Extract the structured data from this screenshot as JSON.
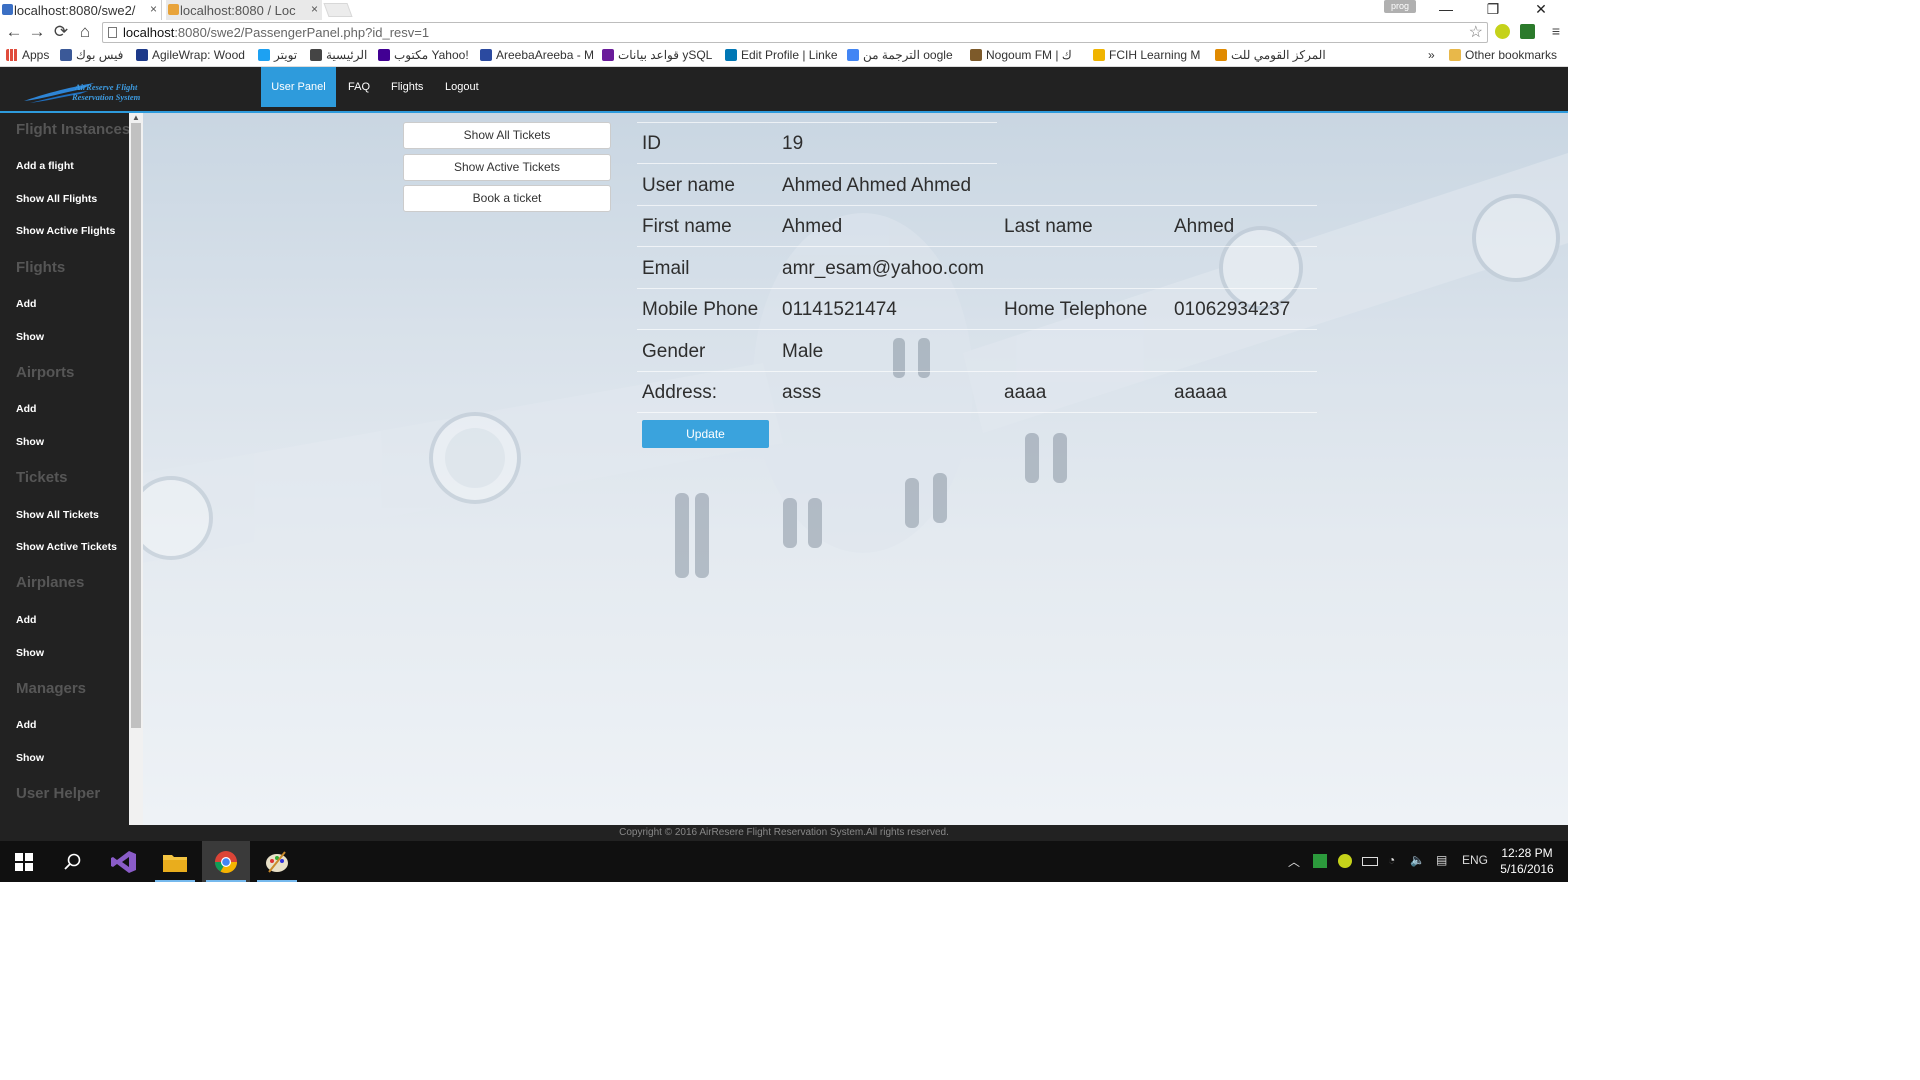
{
  "browser": {
    "tabs": [
      {
        "title": "localhost:8080/swe2/",
        "close": "×"
      },
      {
        "title": "localhost:8080 / Loc",
        "close": "×"
      }
    ],
    "profile_badge": "prog",
    "window_controls": {
      "minimize": "—",
      "restore": "❐",
      "close": "✕"
    },
    "url_host": "localhost",
    "url_path": ":8080/swe2/PassengerPanel.php?id_resv=1",
    "nav": {
      "back": "←",
      "forward": "→",
      "reload": "⟳",
      "home": "⌂"
    },
    "star": "☆",
    "menu": "≡"
  },
  "bookmarks": [
    {
      "label": "Apps",
      "color": "#e04c3c"
    },
    {
      "label": "فيس بوك",
      "color": "#3b5998"
    },
    {
      "label": "AgileWrap: Wood",
      "color": "#1d3a8a"
    },
    {
      "label": "تويتر",
      "color": "#1da1f2"
    },
    {
      "label": "الرئيسية",
      "color": "#444444"
    },
    {
      "label": "مكتوب Yahoo!",
      "color": "#410093"
    },
    {
      "label": "AreebaAreeba - M",
      "color": "#2b4aa0"
    },
    {
      "label": "قواعد بيانات ySQL",
      "color": "#6a1b9a"
    },
    {
      "label": "Edit Profile | Linke",
      "color": "#0077b5"
    },
    {
      "label": "الترجمة من oogle",
      "color": "#4285f4"
    },
    {
      "label": "Nogoum FM | ك",
      "color": "#7d5a2a"
    },
    {
      "label": "FCIH Learning M",
      "color": "#f0b400"
    },
    {
      "label": "المركز القومي للت",
      "color": "#e08a00"
    }
  ],
  "bookmarks_more": "»",
  "bookmarks_other": "Other bookmarks",
  "app": {
    "logo_line1": "AirReserve Flight",
    "logo_line2": "Reservation System",
    "nav": [
      "User Panel",
      "FAQ",
      "Flights",
      "Logout"
    ]
  },
  "sidebar": {
    "sections": [
      {
        "heading": "Flight Instances",
        "items": [
          "Add a flight",
          "Show All Flights",
          "Show Active Flights"
        ]
      },
      {
        "heading": "Flights",
        "items": [
          "Add",
          "Show"
        ]
      },
      {
        "heading": "Airports",
        "items": [
          "Add",
          "Show"
        ]
      },
      {
        "heading": "Tickets",
        "items": [
          "Show All Tickets",
          "Show Active Tickets"
        ]
      },
      {
        "heading": "Airplanes",
        "items": [
          "Add",
          "Show"
        ]
      },
      {
        "heading": "Managers",
        "items": [
          "Add",
          "Show"
        ]
      },
      {
        "heading": "User Helper",
        "items": []
      }
    ]
  },
  "actions": [
    "Show All Tickets",
    "Show Active Tickets",
    "Book a ticket"
  ],
  "profile": {
    "id_label": "ID",
    "id": "19",
    "username_label": "User name",
    "username": "Ahmed Ahmed Ahmed",
    "first_name_label": "First name",
    "first_name": "Ahmed",
    "last_name_label": "Last name",
    "last_name": "Ahmed",
    "email_label": "Email",
    "email": "amr_esam@yahoo.com",
    "mobile_label": "Mobile Phone",
    "mobile": "01141521474",
    "home_tel_label": "Home Telephone",
    "home_tel": "01062934237",
    "gender_label": "Gender",
    "gender": "Male",
    "address_label": "Address:",
    "address_1": "asss",
    "address_2": "aaaa",
    "address_3": "aaaaa",
    "update_label": "Update"
  },
  "footer": "Copyright © 2016 AirResere Flight Reservation System.All rights reserved.",
  "taskbar": {
    "language": "ENG",
    "time": "12:28 PM",
    "date": "5/16/2016"
  },
  "colors": {
    "accent": "#2e9bdc",
    "nav_bg": "#222222",
    "update_button": "#3aa3dd"
  }
}
